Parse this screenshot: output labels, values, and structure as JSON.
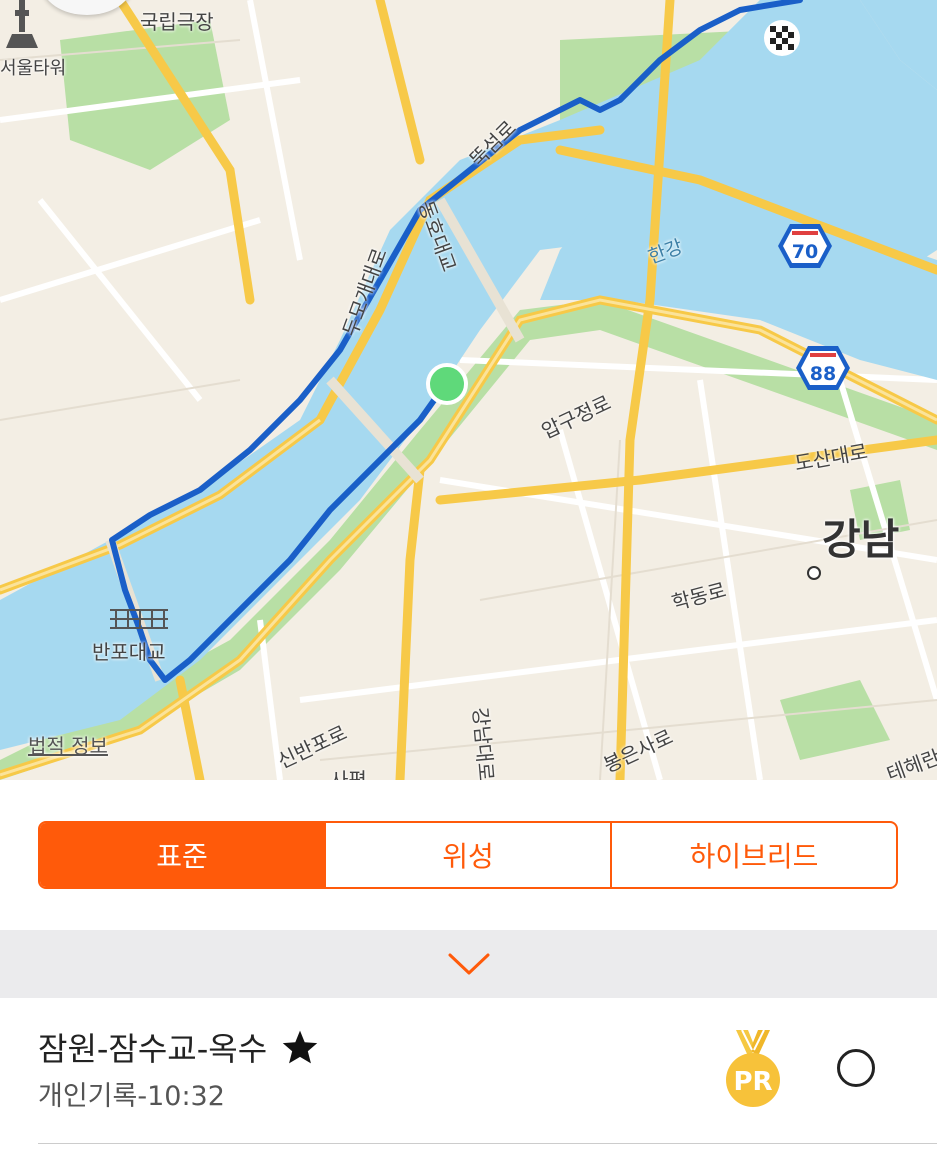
{
  "map": {
    "labels": {
      "national_theater": "국립극장",
      "seoul_tower": "서울타워",
      "ttukseom_ro": "뚝섬로",
      "dongho_bridge": "동호대교",
      "dumo_gae_daero": "두모개대로",
      "hangang": "한강",
      "apgujeong_ro": "압구정로",
      "dosan_daero": "도산대로",
      "gangnam": "강남",
      "hakdong_ro": "학동로",
      "banpo_bridge": "반포대교",
      "legal_info": "법적 정보",
      "sinbanpo_ro": "신반포로",
      "gangnam_daero": "강남대로",
      "bongeunsa_ro": "봉은사로",
      "teheran_ro": "테헤란",
      "sapyeong": "사평"
    },
    "highway_shields": [
      "70",
      "88"
    ],
    "colors": {
      "water": "#a6d9f0",
      "park": "#b8dfa5",
      "road_major": "#f7c948",
      "route": "#1a5fc8",
      "start_marker": "#5fd97a"
    },
    "icons": [
      "seoul-tower-icon",
      "finish-flag-icon",
      "start-marker-icon",
      "district-dot-icon"
    ]
  },
  "map_type": {
    "options": [
      "표준",
      "위성",
      "하이브리드"
    ],
    "selected": "표준"
  },
  "accent_color": "#ff5a0a",
  "route": {
    "title": "잠원-잠수교-옥수",
    "starred": true,
    "subtitle": "개인기록-10:32",
    "badge": "PR"
  }
}
